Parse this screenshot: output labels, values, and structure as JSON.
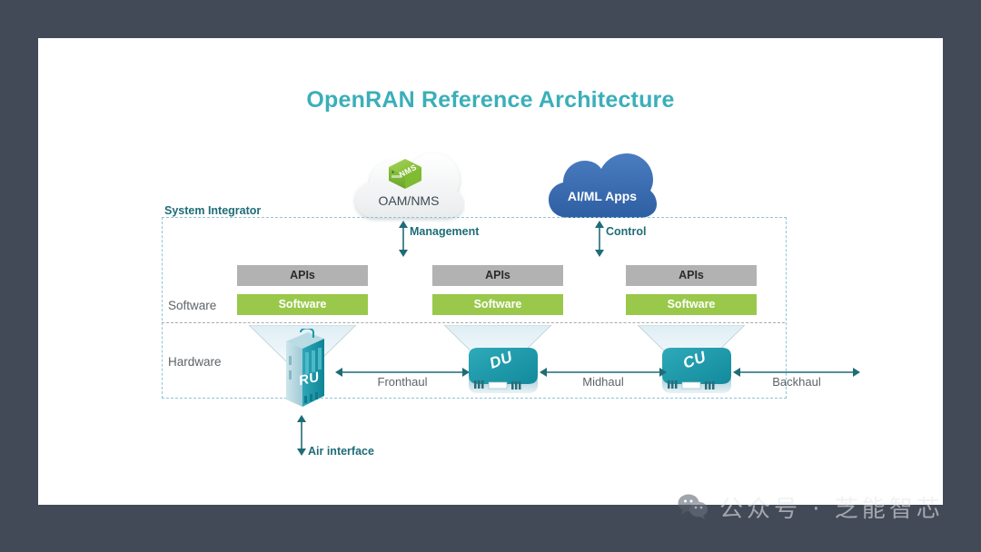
{
  "page": {
    "background_color": "#434a57",
    "card_color": "#ffffff"
  },
  "title": "OpenRAN Reference Architecture",
  "colors": {
    "title": "#3aafb9",
    "accent_teal": "#1f6c77",
    "api_bar": "#b2b2b2",
    "software_bar": "#9ac84b",
    "device_teal": "#1896a6",
    "cloud_blue": "#3d6fb4",
    "nms_green": "#8cc63f",
    "dashed_border": "#8fc4d8",
    "label_gray": "#5d6468"
  },
  "clouds": [
    {
      "name": "oam-nms-cloud",
      "label": "OAM/NMS",
      "badge": "NMS",
      "badge_icon": "green-server-box-icon",
      "style": "white"
    },
    {
      "name": "ai-ml-cloud",
      "label": "AI/ML Apps",
      "style": "blue"
    }
  ],
  "vertical_links": [
    {
      "name": "management-link",
      "label": "Management"
    },
    {
      "name": "control-link",
      "label": "Control"
    }
  ],
  "system_integrator": {
    "label": "System Integrator",
    "row_labels": {
      "software": "Software",
      "hardware": "Hardware"
    },
    "stacks": [
      {
        "name": "ru-stack",
        "api_label": "APIs",
        "software_label": "Software",
        "device": "RU"
      },
      {
        "name": "du-stack",
        "api_label": "APIs",
        "software_label": "Software",
        "device": "DU"
      },
      {
        "name": "cu-stack",
        "api_label": "APIs",
        "software_label": "Software",
        "device": "CU"
      }
    ]
  },
  "horizontal_links": [
    {
      "name": "fronthaul-link",
      "label": "Fronthaul"
    },
    {
      "name": "midhaul-link",
      "label": "Midhaul"
    },
    {
      "name": "backhaul-link",
      "label": "Backhaul"
    }
  ],
  "air_interface": {
    "label": "Air interface"
  },
  "watermark": {
    "icon": "wechat-icon",
    "text": "公众号 · 芝能智芯"
  }
}
